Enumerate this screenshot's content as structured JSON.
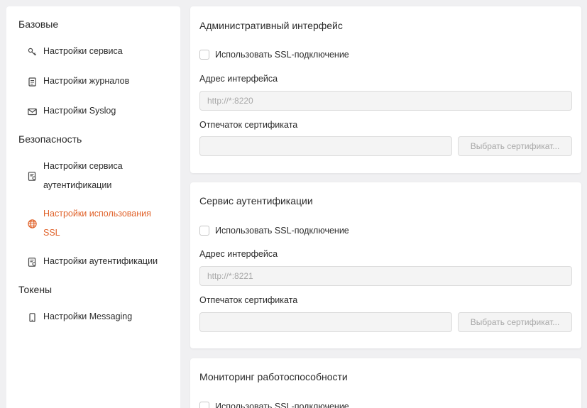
{
  "sidebar": {
    "sections": [
      {
        "title": "Базовые",
        "items": [
          {
            "label": "Настройки сервиса",
            "icon": "key-icon"
          },
          {
            "label": "Настройки журналов",
            "icon": "document-icon"
          },
          {
            "label": "Настройки Syslog",
            "icon": "envelope-icon"
          }
        ]
      },
      {
        "title": "Безопасность",
        "items": [
          {
            "label_line1": "Настройки сервиса",
            "label_line2": "аутентификации",
            "icon": "certificate-icon"
          },
          {
            "label_line1": "Настройки использования",
            "label_line2": "SSL",
            "icon": "globe-icon",
            "active": true
          },
          {
            "label": "Настройки аутентификации",
            "icon": "certificate-icon"
          }
        ]
      },
      {
        "title": "Токены",
        "items": [
          {
            "label": "Настройки Messaging",
            "icon": "phone-icon"
          }
        ]
      }
    ]
  },
  "colors": {
    "accent": "#e0622a",
    "background": "#f0f0f2",
    "card": "#ffffff"
  },
  "cards": [
    {
      "title": "Административный интерфейс",
      "ssl_label": "Использовать SSL-подключение",
      "ssl_checked": false,
      "address_label": "Адрес интерфейса",
      "address_value": "http://*:8220",
      "thumbprint_label": "Отпечаток сертификата",
      "thumbprint_value": "",
      "select_cert_label": "Выбрать сертификат..."
    },
    {
      "title": "Сервис аутентификации",
      "ssl_label": "Использовать SSL-подключение",
      "ssl_checked": false,
      "address_label": "Адрес интерфейса",
      "address_value": "http://*:8221",
      "thumbprint_label": "Отпечаток сертификата",
      "thumbprint_value": "",
      "select_cert_label": "Выбрать сертификат..."
    },
    {
      "title": "Мониторинг работоспособности",
      "ssl_label": "Использовать SSL-подключение",
      "ssl_checked": false
    }
  ]
}
